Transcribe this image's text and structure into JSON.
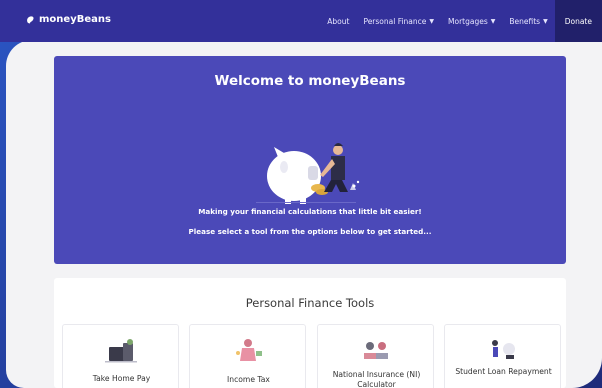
{
  "brand": {
    "name": "moneyBeans"
  },
  "nav": {
    "items": [
      {
        "label": "About",
        "has_caret": false
      },
      {
        "label": "Personal Finance",
        "has_caret": true
      },
      {
        "label": "Mortgages",
        "has_caret": true
      },
      {
        "label": "Benefits",
        "has_caret": true
      },
      {
        "label": "Donate",
        "has_caret": false
      }
    ],
    "caret_glyph": "▼"
  },
  "hero": {
    "title": "Welcome to moneyBeans",
    "line1": "Making your financial calculations that little bit easier!",
    "line2": "Please select a tool from the options below to get started..."
  },
  "tools": {
    "title": "Personal Finance Tools",
    "cards": [
      {
        "label": "Take Home Pay",
        "icon": "payslip-illustration-icon"
      },
      {
        "label": "Income Tax",
        "icon": "person-money-illustration-icon"
      },
      {
        "label": "National Insurance (NI) Calculator",
        "icon": "people-illustration-icon"
      },
      {
        "label": "Student Loan Repayment",
        "icon": "graduate-illustration-icon"
      }
    ]
  },
  "colors": {
    "navbar": "#33309a",
    "hero": "#4b49b8",
    "donate": "#21206a",
    "background": "#f3f3f5"
  }
}
